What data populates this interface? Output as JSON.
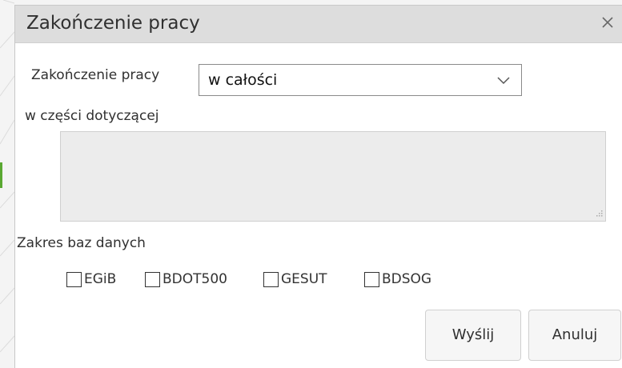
{
  "dialog": {
    "title": "Zakończenie pracy",
    "close_icon": "close-icon"
  },
  "form": {
    "completion_label": "Zakończenie pracy",
    "completion_value": "w całości",
    "partial_label": "w części dotyczącej",
    "partial_text": "",
    "databases_label": "Zakres baz danych",
    "databases": [
      {
        "label": "EGiB",
        "checked": false
      },
      {
        "label": "BDOT500",
        "checked": false
      },
      {
        "label": "GESUT",
        "checked": false
      },
      {
        "label": "BDSOG",
        "checked": false
      }
    ]
  },
  "buttons": {
    "send_label": "Wyślij",
    "cancel_label": "Anuluj"
  }
}
